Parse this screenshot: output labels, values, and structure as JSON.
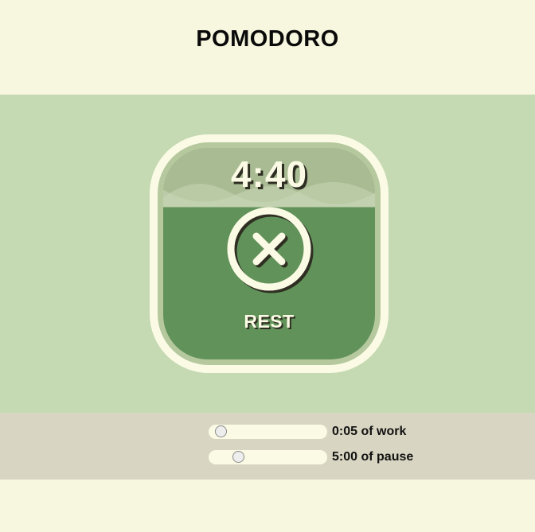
{
  "app": {
    "title": "POMODORO"
  },
  "timer": {
    "time": "4:40",
    "mode": "REST",
    "fill_fraction": 0.72,
    "action_icon": "close-icon"
  },
  "settings": {
    "work": {
      "value": "0:05",
      "suffix": " of work",
      "slider_fraction": 0.05
    },
    "pause": {
      "value": "5:00",
      "suffix": " of pause",
      "slider_fraction": 0.22
    }
  },
  "colors": {
    "background": "#f7f6de",
    "stage": "#c5d9b3",
    "liquid": "#619259",
    "liquid_top": "#a9bb93",
    "bezel": "#fbfbe5",
    "settings_bar": "#d8d6c2"
  }
}
